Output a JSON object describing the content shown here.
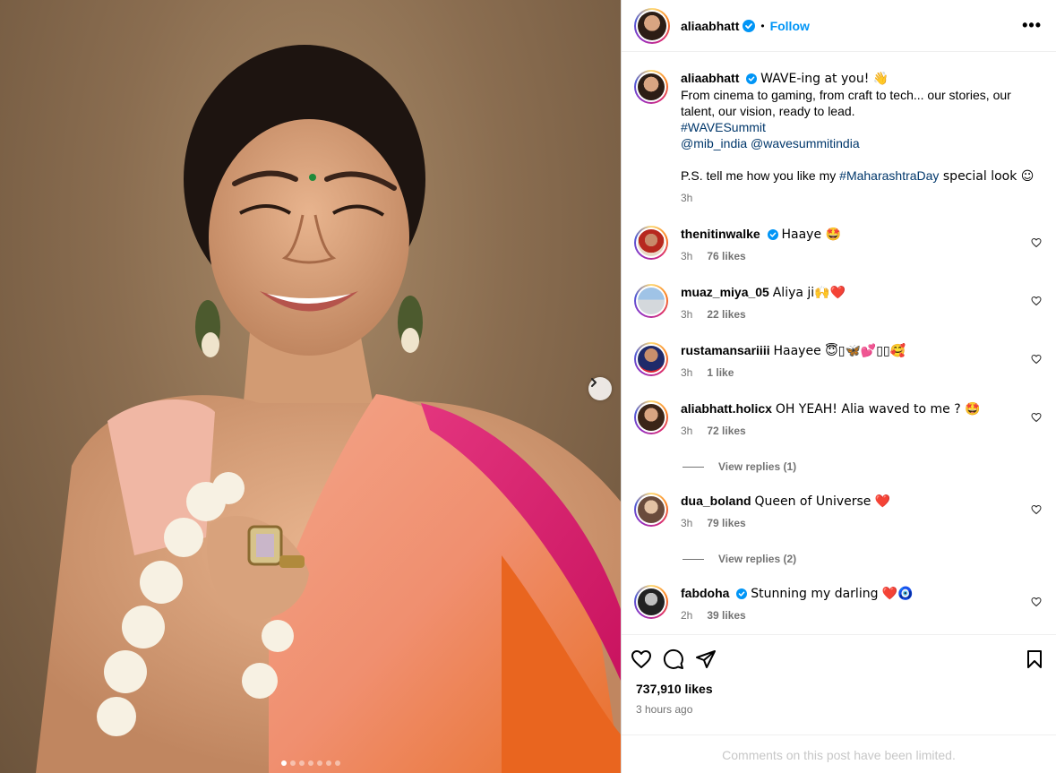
{
  "post": {
    "username": "aliaabhatt",
    "follow_label": "Follow",
    "separator": "•",
    "more_label": "•••",
    "caption": {
      "username": "aliaabhatt",
      "line1_text": "WAVE-ing at you! 👋",
      "line2": "From cinema to gaming, from craft to tech... our stories, our talent, our vision, ready to lead.",
      "hashtag": "#WAVESummit",
      "mention1": "@mib_india",
      "mention2": "@wavesummitindia",
      "ps_prefix": "P.S. tell me how you like my ",
      "ps_hashtag": "#MaharashtraDay",
      "ps_suffix": " special look ☺",
      "time": "3h"
    },
    "likes": "737,910 likes",
    "posted": "3 hours ago",
    "comments_limited": "Comments on this post have been limited."
  },
  "comments": [
    {
      "username": "thenitinwalke",
      "verified": true,
      "text": "Haaye 🤩",
      "time": "3h",
      "likes": "76 likes"
    },
    {
      "username": "muaz_miya_05",
      "verified": false,
      "text": "Aliya ji🙌❤️",
      "time": "3h",
      "likes": "22 likes"
    },
    {
      "username": "rustamansariiii",
      "verified": false,
      "text": "Haayee 😇▯🦋💕▯▯🥰",
      "time": "3h",
      "likes": "1 like"
    },
    {
      "username": "aliabhatt.holicx",
      "verified": false,
      "text": "OH YEAH! Alia waved to me ? 🤩",
      "time": "3h",
      "likes": "72 likes",
      "replies": "View replies (1)"
    },
    {
      "username": "dua_boland",
      "verified": false,
      "text": "Queen of Universe ❤️",
      "time": "3h",
      "likes": "79 likes",
      "replies": "View replies (2)"
    },
    {
      "username": "fabdoha",
      "verified": true,
      "text": "Stunning my darling ❤️🧿",
      "time": "2h",
      "likes": "39 likes"
    }
  ],
  "carousel": {
    "slide_count": 7,
    "active_index": 0
  },
  "icons": {
    "like": "heart-icon",
    "comment": "comment-icon",
    "share": "share-icon",
    "save": "bookmark-icon",
    "next": "chevron-right-icon",
    "verified": "verified-badge-icon"
  },
  "colors": {
    "accent": "#0095f6",
    "link": "#00376b",
    "muted": "#737373",
    "verified": "#0095f6"
  }
}
